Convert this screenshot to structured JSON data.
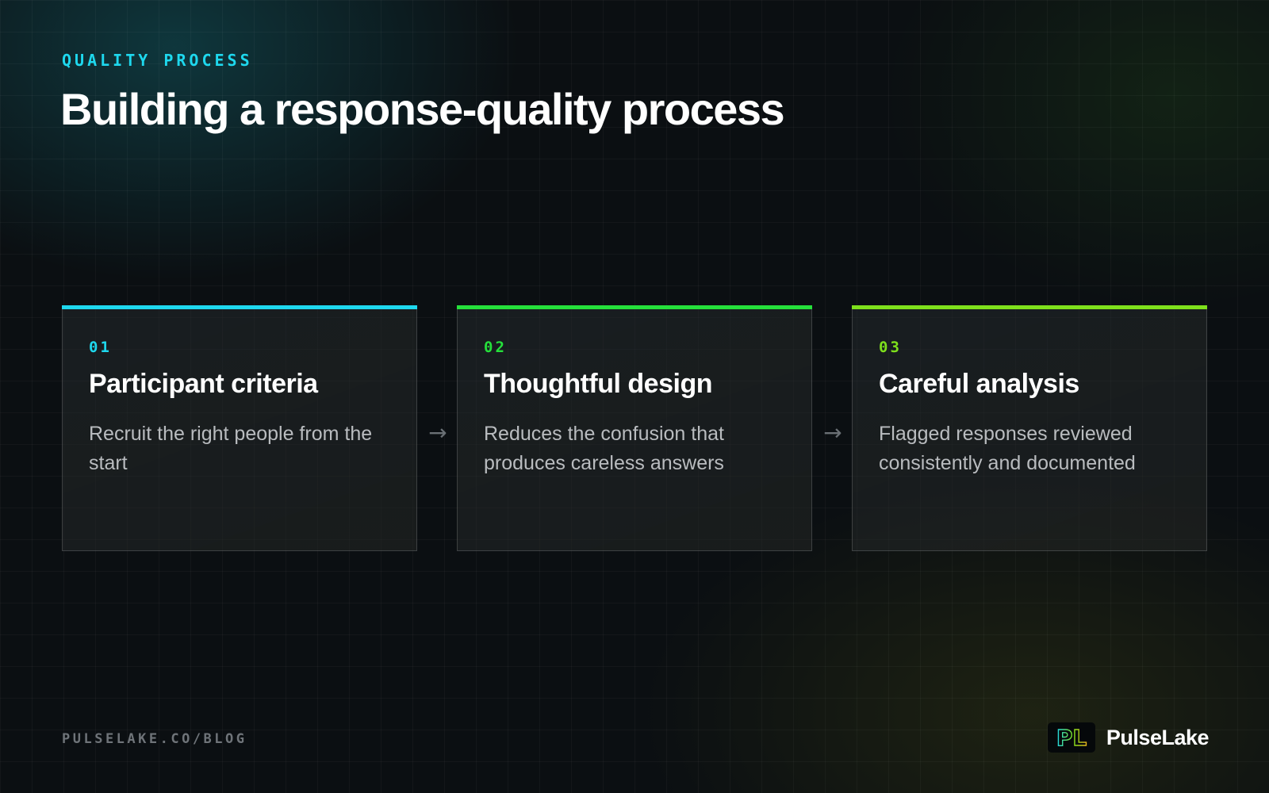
{
  "eyebrow": "QUALITY PROCESS",
  "title": "Building a response-quality process",
  "steps": [
    {
      "number": "01",
      "title": "Participant criteria",
      "description": "Recruit the right people from the start",
      "accent": "#1ed8ee"
    },
    {
      "number": "02",
      "title": "Thoughtful design",
      "description": "Reduces the confusion that produces careless answers",
      "accent": "#25e03b"
    },
    {
      "number": "03",
      "title": "Careful analysis",
      "description": "Flagged responses reviewed consistently and documented",
      "accent": "#7ee01c"
    }
  ],
  "arrow_glyph": "→",
  "footer": {
    "url": "PULSELAKE.CO/BLOG",
    "brand_name": "PulseLake",
    "logo_text": "PL"
  },
  "colors": {
    "background": "#0b0f12",
    "text_muted": "#b9bcbf"
  },
  "icons": [
    "arrow-right-icon",
    "pulselake-logo-icon"
  ]
}
